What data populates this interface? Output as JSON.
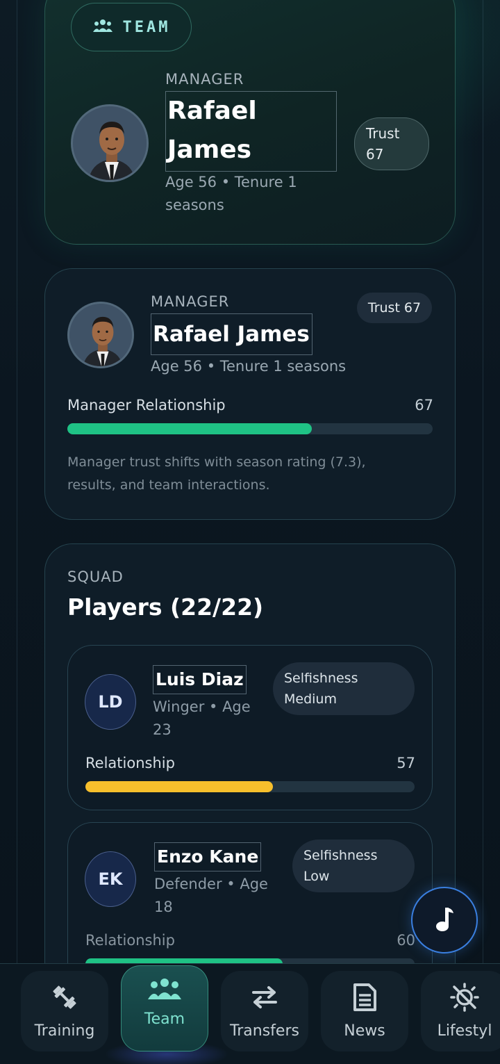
{
  "header_chip": {
    "label": "TEAM",
    "icon": "team-icon"
  },
  "hero_manager": {
    "section_label": "MANAGER",
    "name_line1": "Rafael",
    "name_line2": "James",
    "meta_line1": "Age 56 • Tenure 1",
    "meta_line2": "seasons",
    "trust_label": "Trust",
    "trust_value": "67"
  },
  "manager_card": {
    "section_label": "MANAGER",
    "name": "Rafael James",
    "meta": "Age 56 • Tenure 1 seasons",
    "trust_badge": "Trust 67",
    "relationship_label": "Manager Relationship",
    "relationship_value": "67",
    "relationship_fraction": 0.67,
    "note_line1": "Manager trust shifts with season rating (7.3),",
    "note_line2": "results, and team interactions.",
    "bar_color": "#1fc285"
  },
  "squad": {
    "section_label": "SQUAD",
    "title": "Players (22/22)",
    "players": [
      {
        "initials": "LD",
        "name": "Luis Diaz",
        "role_line1": "Winger • Age",
        "role_line2": "23",
        "selfishness_label": "Selfishness",
        "selfishness_value": "Medium",
        "relationship_label": "Relationship",
        "relationship_value": "57",
        "relationship_fraction": 0.57,
        "bar_color": "#f7bf2c"
      },
      {
        "initials": "EK",
        "name": "Enzo Kane",
        "role_line1": "Defender • Age",
        "role_line2": "18",
        "selfishness_label": "Selfishness",
        "selfishness_value": "Low",
        "relationship_label": "Relationship",
        "relationship_value": "60",
        "relationship_fraction": 0.6,
        "bar_color": "#1fc285"
      }
    ]
  },
  "music_button": {
    "icon": "music-note-icon"
  },
  "nav": {
    "items": [
      {
        "label": "Training",
        "icon": "dumbbell-icon",
        "active": false
      },
      {
        "label": "Team",
        "icon": "team-icon",
        "active": true
      },
      {
        "label": "Transfers",
        "icon": "transfer-arrows-icon",
        "active": false
      },
      {
        "label": "News",
        "icon": "news-icon",
        "active": false
      },
      {
        "label": "Lifestyl",
        "icon": "lifestyle-icon",
        "active": false
      }
    ]
  },
  "colors": {
    "accent": "#7fe3d0",
    "green": "#1fc285",
    "yellow": "#f7bf2c",
    "fab_border": "#3a7fe0"
  }
}
